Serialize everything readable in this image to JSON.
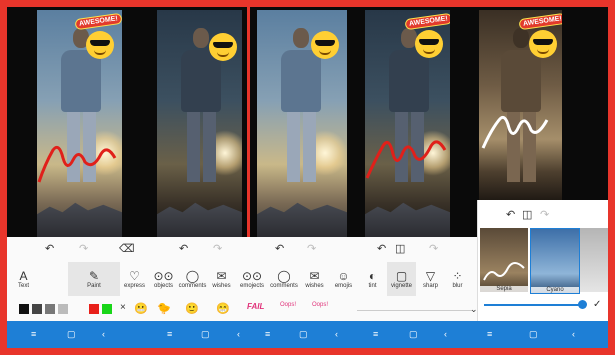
{
  "stickers": {
    "awesome": "AWESOME!"
  },
  "tools": [
    {
      "label": "Text",
      "icon": "A"
    },
    {
      "label": "Paint",
      "icon": "✎"
    },
    {
      "label": "express",
      "icon": "♡"
    },
    {
      "label": "objects",
      "icon": "⊙⊙"
    },
    {
      "label": "comments",
      "icon": "◯"
    },
    {
      "label": "wishes",
      "icon": "✉"
    },
    {
      "label": "emojects",
      "icon": "⊙⊙"
    },
    {
      "label": "comments",
      "icon": "◯"
    },
    {
      "label": "wishes",
      "icon": "✉"
    },
    {
      "label": "emojis",
      "icon": "☺"
    },
    {
      "label": "tint",
      "icon": "◐"
    },
    {
      "label": "vignette",
      "icon": "▢"
    },
    {
      "label": "sharp",
      "icon": "▽"
    },
    {
      "label": "blur",
      "icon": "⁘"
    }
  ],
  "sticker_strip": [
    "×",
    "FAIL",
    "Oops!",
    "Oops!"
  ],
  "filters": [
    {
      "label": "Sepia"
    },
    {
      "label": "Cyano"
    }
  ],
  "nav": {
    "menu": "≡",
    "home": "▢",
    "back": "‹"
  },
  "colors": {
    "accent": "#1e7fd6",
    "frame": "#e8352b",
    "paint": "#e0201a"
  }
}
